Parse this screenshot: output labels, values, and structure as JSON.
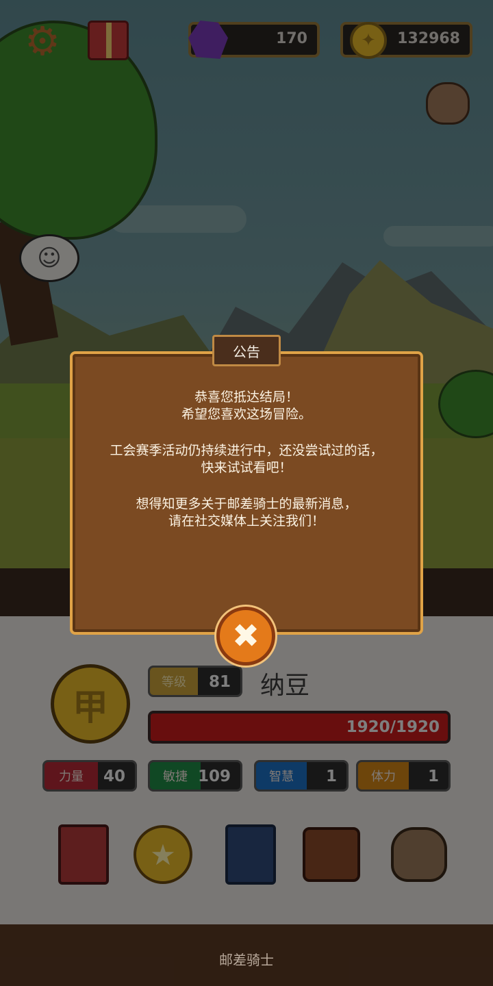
{
  "hud": {
    "gems": "170",
    "gold": "132968",
    "icons": [
      "gear-icon",
      "gift-icon",
      "gem-icon",
      "gold-coin-icon",
      "loot-sack-icon"
    ]
  },
  "dialog": {
    "title": "公告",
    "line1": "恭喜您抵达结局！",
    "line2": "希望您喜欢这场冒险。",
    "line3": "工会赛季活动仍持续进行中，还没尝试过的话，",
    "line4": "快来试试看吧！",
    "line5": "想得知更多关于邮差骑士的最新消息，",
    "line6": "请在社交媒体上关注我们！",
    "close_icon": "close-icon"
  },
  "character": {
    "rank": "甲",
    "level_label": "等级",
    "level": "81",
    "name": "纳豆",
    "hp": "1920/1920",
    "hp_fraction": 1.0
  },
  "stats": {
    "str_label": "力量",
    "str": "40",
    "agi_label": "敏捷",
    "agi": "109",
    "int_label": "智慧",
    "int": "1",
    "sta_label": "体力",
    "sta": "1"
  },
  "menu": [
    "book-icon",
    "star-coin-icon",
    "cards-icon",
    "inventory-bag-icon",
    "loot-sack-icon"
  ],
  "footer": {
    "app_name": "邮差骑士"
  },
  "colors": {
    "dialog_bg": "#7b4a22",
    "dialog_border": "#e0a347",
    "hp_red": "#c81b1b",
    "str": "#b42a36",
    "agi": "#1f8a45",
    "int": "#1b6fc4",
    "sta": "#d18416",
    "close": "#e47a1a"
  }
}
